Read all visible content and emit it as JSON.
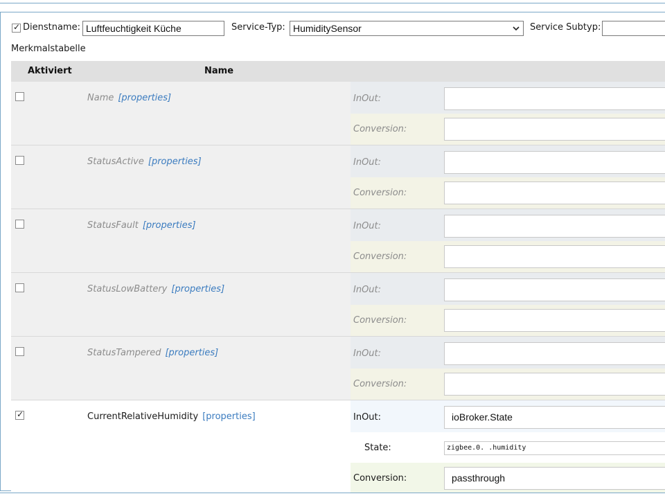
{
  "service": {
    "enabled": true,
    "name_label": "Dienstname:",
    "name_value": "Luftfeuchtigkeit Küche",
    "type_label": "Service-Typ:",
    "type_value": "HumiditySensor",
    "subtype_label": "Service Subtyp:",
    "subtype_value": ""
  },
  "table": {
    "title": "Merkmalstabelle",
    "col_active": "Aktiviert",
    "col_name": "Name",
    "props_link": "[properties]",
    "inout_label": "InOut:",
    "conversion_label": "Conversion:",
    "state_label": "State:",
    "rows": [
      {
        "name": "Name",
        "active": false,
        "inout": "",
        "conversion": ""
      },
      {
        "name": "StatusActive",
        "active": false,
        "inout": "",
        "conversion": ""
      },
      {
        "name": "StatusFault",
        "active": false,
        "inout": "",
        "conversion": ""
      },
      {
        "name": "StatusLowBattery",
        "active": false,
        "inout": "",
        "conversion": ""
      },
      {
        "name": "StatusTampered",
        "active": false,
        "inout": "",
        "conversion": ""
      },
      {
        "name": "CurrentRelativeHumidity",
        "active": true,
        "inout": "ioBroker.State",
        "state": "zigbee.0.                 .humidity",
        "conversion": "passthrough"
      }
    ]
  }
}
